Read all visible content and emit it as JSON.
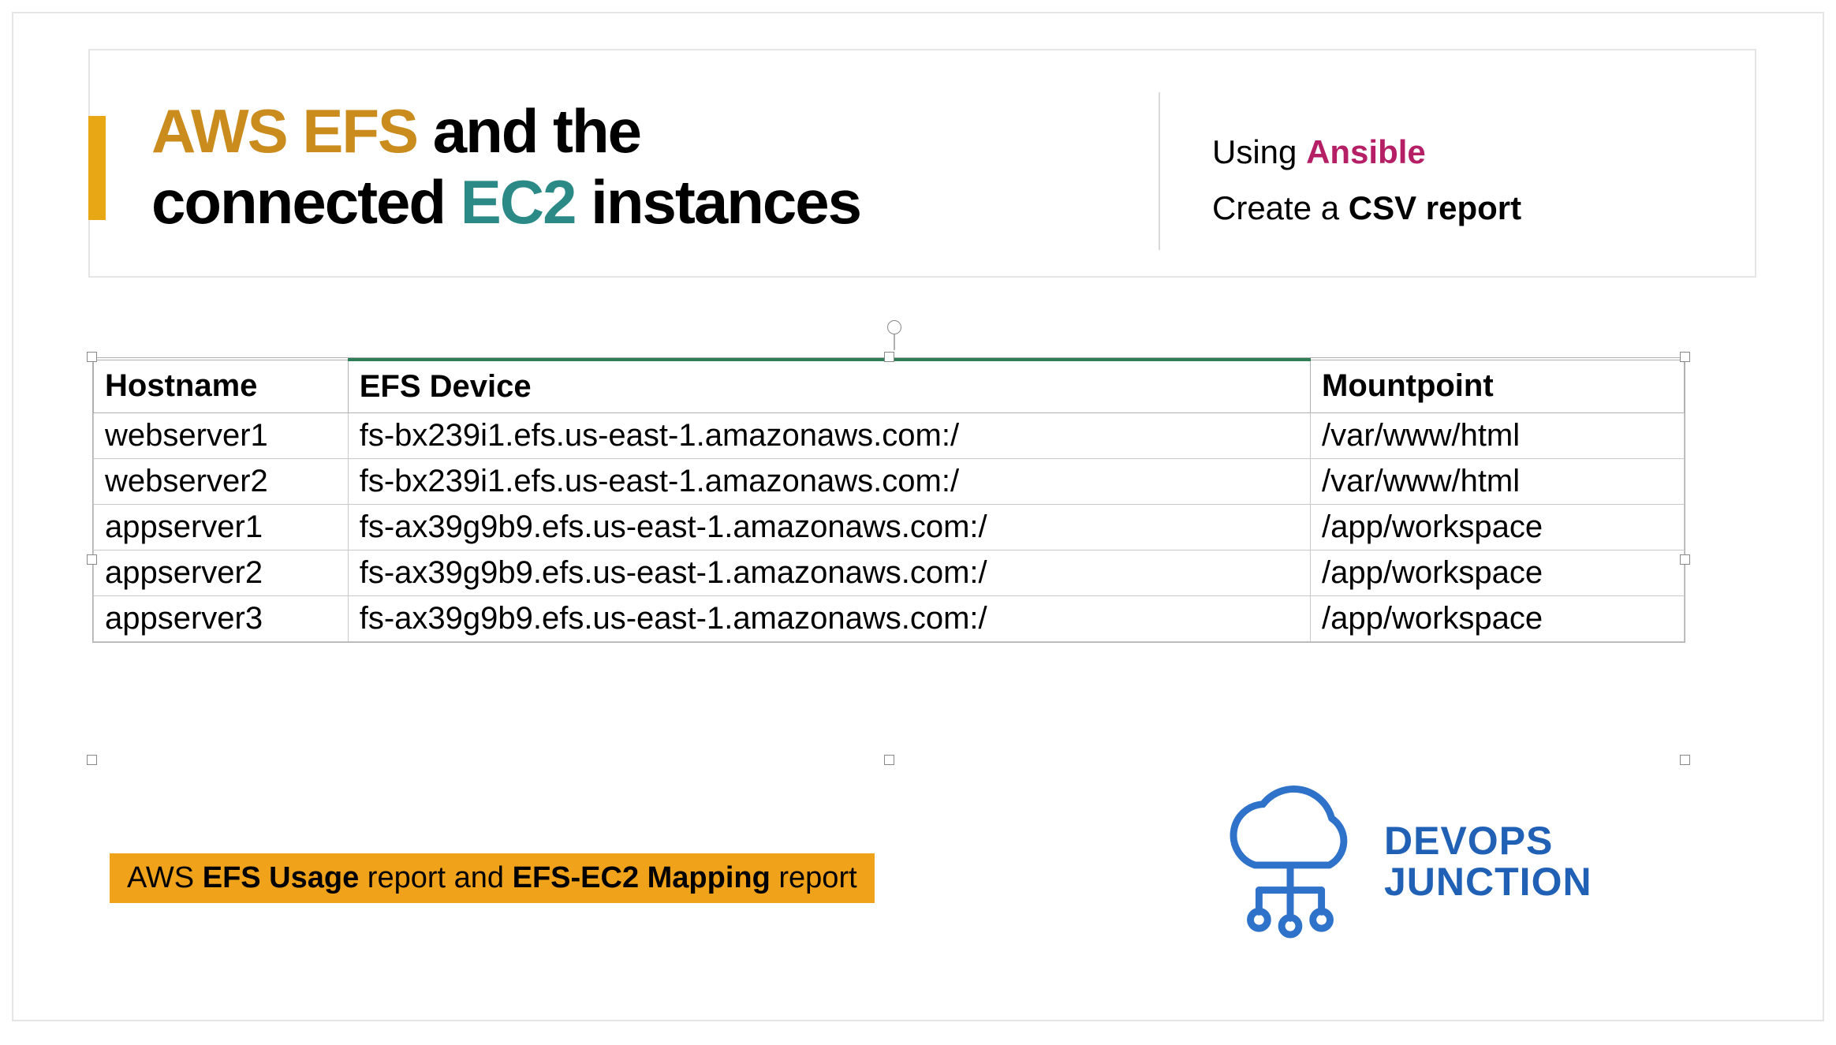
{
  "header": {
    "title_part1": "AWS EFS",
    "title_mid": " and the",
    "title_line2a": "connected ",
    "title_part2": "EC2",
    "title_line2b": " instances",
    "subtitle_line1_a": "Using ",
    "subtitle_line1_b": "Ansible",
    "subtitle_line2_a": "Create a ",
    "subtitle_line2_b": "CSV report"
  },
  "table": {
    "columns": [
      "Hostname",
      "EFS Device",
      "Mountpoint"
    ],
    "rows": [
      {
        "hostname": "webserver1",
        "efs": "fs-bx239i1.efs.us-east-1.amazonaws.com:/",
        "mount": "/var/www/html"
      },
      {
        "hostname": "webserver2",
        "efs": "fs-bx239i1.efs.us-east-1.amazonaws.com:/",
        "mount": "/var/www/html"
      },
      {
        "hostname": "appserver1",
        "efs": "fs-ax39g9b9.efs.us-east-1.amazonaws.com:/",
        "mount": "/app/workspace"
      },
      {
        "hostname": "appserver2",
        "efs": "fs-ax39g9b9.efs.us-east-1.amazonaws.com:/",
        "mount": "/app/workspace"
      },
      {
        "hostname": "appserver3",
        "efs": "fs-ax39g9b9.efs.us-east-1.amazonaws.com:/",
        "mount": "/app/workspace"
      }
    ]
  },
  "footer": {
    "a": "AWS ",
    "b": "EFS Usage",
    "c": " report and  ",
    "d": "EFS-EC2 Mapping",
    "e": " report"
  },
  "logo": {
    "line1": "DEVOPS",
    "line2": "JUNCTION"
  },
  "colors": {
    "orange": "#c98c1d",
    "teal": "#2b8a86",
    "accent": "#e8a816",
    "magenta": "#b51f66",
    "blue": "#2060b5",
    "footer_bg": "#efa21a"
  }
}
